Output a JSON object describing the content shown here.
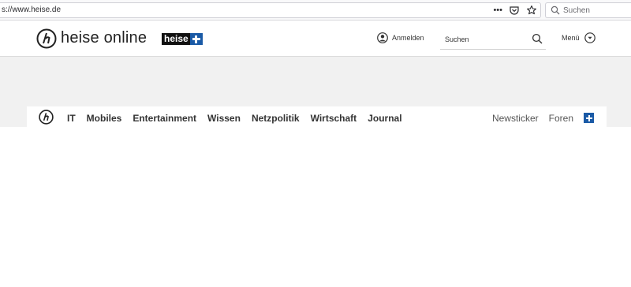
{
  "browser": {
    "url": "s://www.heise.de",
    "search_placeholder": "Suchen",
    "icons": [
      "more-dots-icon",
      "pocket-icon",
      "bookmark-star-icon",
      "search-icon"
    ]
  },
  "header": {
    "logo_text": "heise online",
    "plus_badge_text": "heise",
    "login_label": "Anmelden",
    "search_placeholder": "Suchen",
    "menu_label": "Menü"
  },
  "nav": {
    "items": [
      {
        "label": "IT"
      },
      {
        "label": "Mobiles"
      },
      {
        "label": "Entertainment"
      },
      {
        "label": "Wissen"
      },
      {
        "label": "Netzpolitik"
      },
      {
        "label": "Wirtschaft"
      },
      {
        "label": "Journal"
      }
    ],
    "right_items": [
      {
        "label": "Newsticker"
      },
      {
        "label": "Foren"
      }
    ]
  },
  "colors": {
    "brand_blue": "#1a5aa6",
    "text_dark": "#333333",
    "ad_band_gray": "#f1f1f1"
  }
}
